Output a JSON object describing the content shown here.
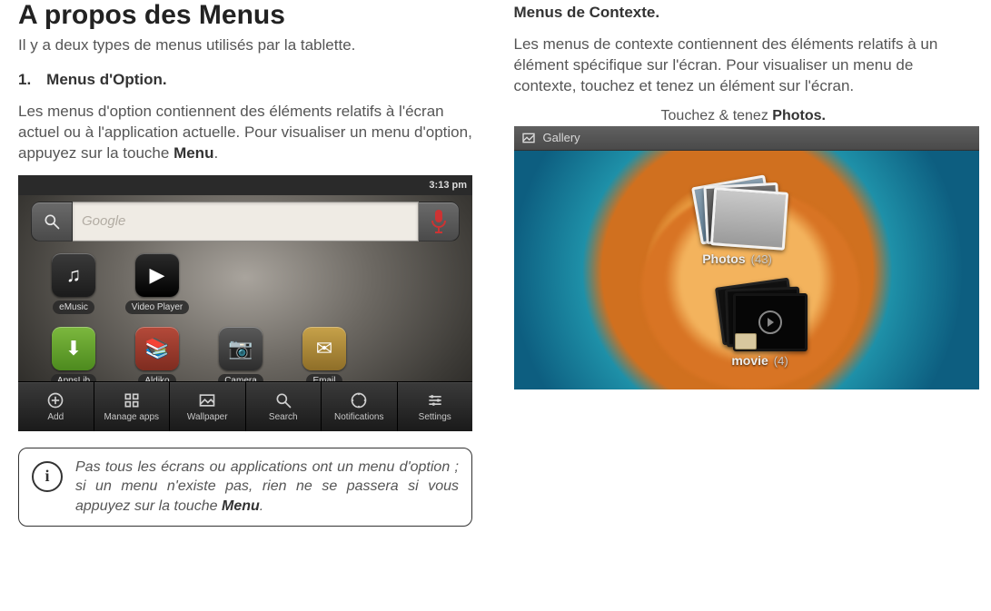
{
  "left": {
    "title": "A propos des Menus",
    "intro": "Il y a deux types de menus utilisés par la tablette.",
    "section_heading": "1. Menus d'Option.",
    "body_pre": "Les menus d'option contiennent des éléments relatifs à l'écran actuel ou à l'application actuelle. Pour visualiser un menu d'option, appuyez sur la touche ",
    "body_bold": "Menu",
    "body_post": "."
  },
  "statusbar": {
    "clock": "3:13 pm"
  },
  "search_placeholder": "Google",
  "apps_row1": [
    {
      "label": "eMusic",
      "cls": "ico-emusic",
      "glyph": "♫"
    },
    {
      "label": "Video Player",
      "cls": "ico-video",
      "glyph": "▶"
    }
  ],
  "apps_row2": [
    {
      "label": "AppsLib",
      "cls": "ico-appslib",
      "glyph": "⬇"
    },
    {
      "label": "Aldiko",
      "cls": "ico-aldiko",
      "glyph": "📚"
    },
    {
      "label": "Camera",
      "cls": "ico-camera",
      "glyph": "📷"
    },
    {
      "label": "Email",
      "cls": "ico-email",
      "glyph": "✉"
    }
  ],
  "options_menu": [
    {
      "label": "Add",
      "icon": "plus"
    },
    {
      "label": "Manage apps",
      "icon": "apps"
    },
    {
      "label": "Wallpaper",
      "icon": "image"
    },
    {
      "label": "Search",
      "icon": "search"
    },
    {
      "label": "Notifications",
      "icon": "bell"
    },
    {
      "label": "Settings",
      "icon": "gear"
    }
  ],
  "info_note": {
    "text_pre": "Pas tous les écrans ou applications ont un menu d'option ; si un menu n'existe pas, rien ne se passera si vous appuyez sur la touche ",
    "bold": "Menu",
    "text_post": "."
  },
  "right": {
    "section_heading": "Menus de Contexte.",
    "body": "Les menus de contexte contiennent des éléments relatifs à un élément spécifique sur l'écran. Pour visualiser un menu de contexte, touchez et tenez un élément sur l'écran.",
    "caption_pre": "Touchez & tenez ",
    "caption_bold": "Photos."
  },
  "gallery": {
    "header": "Gallery",
    "albums": {
      "photos": {
        "name": "Photos",
        "count": "(43)"
      },
      "movie": {
        "name": "movie",
        "count": "(4)"
      }
    }
  }
}
